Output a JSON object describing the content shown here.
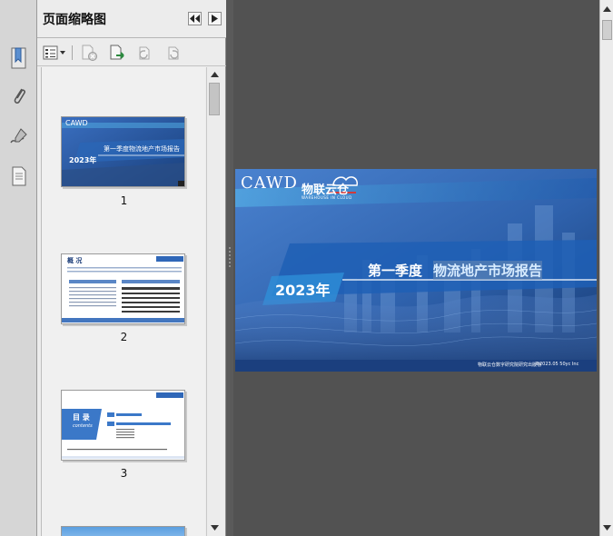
{
  "panel": {
    "title": "页面缩略图"
  },
  "thumbnails": [
    {
      "page": "1",
      "cover_year": "2023年",
      "cover_title": "第一季度物流地产市场报告"
    },
    {
      "page": "2",
      "heading": "概 况"
    },
    {
      "page": "3",
      "heading": "目 录",
      "sub": "contents"
    }
  ],
  "slide": {
    "logo_text": "CAWD",
    "brand_text": "物联云仓",
    "brand_sub": "WAREHOUSE IN CLOUD",
    "title_part1": "第一季度",
    "title_part2": "物流地产市场报告",
    "year": "2023年",
    "footer_left": "物联云仓数字研究院研究出版物",
    "footer_right": "©2023.05 50yc Inc"
  },
  "colors": {
    "panel_bg": "#ececec",
    "doc_bg": "#525252",
    "slide_blue": "#1f4f9b"
  }
}
